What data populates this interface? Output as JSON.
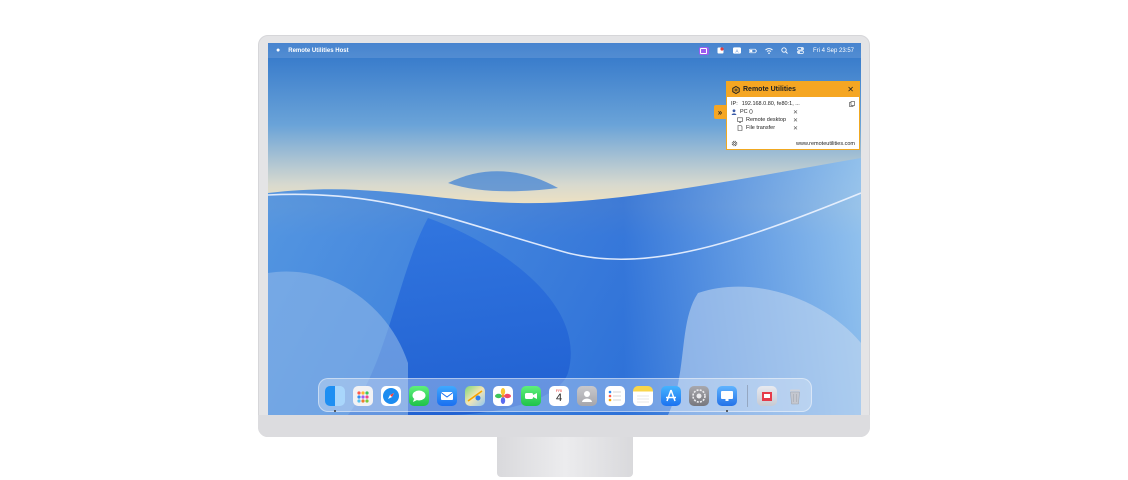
{
  "menubar": {
    "app_name": "Remote Utilities Host",
    "datetime": "Fri 4 Sep  23:57"
  },
  "panel": {
    "title": "Remote Utilities",
    "close": "✕",
    "ip_label": "IP:",
    "ip_value": "192.168.0.80, fe80:1, ...",
    "pc_label": "PC ()",
    "sessions": [
      {
        "label": "Remote desktop",
        "close": "✕"
      },
      {
        "label": "File transfer",
        "close": "✕"
      }
    ],
    "pc_close": "✕",
    "website": "www.remoteutilities.com",
    "expand": "»"
  },
  "dock": {
    "calendar_month": "FRI",
    "calendar_day": "4"
  }
}
